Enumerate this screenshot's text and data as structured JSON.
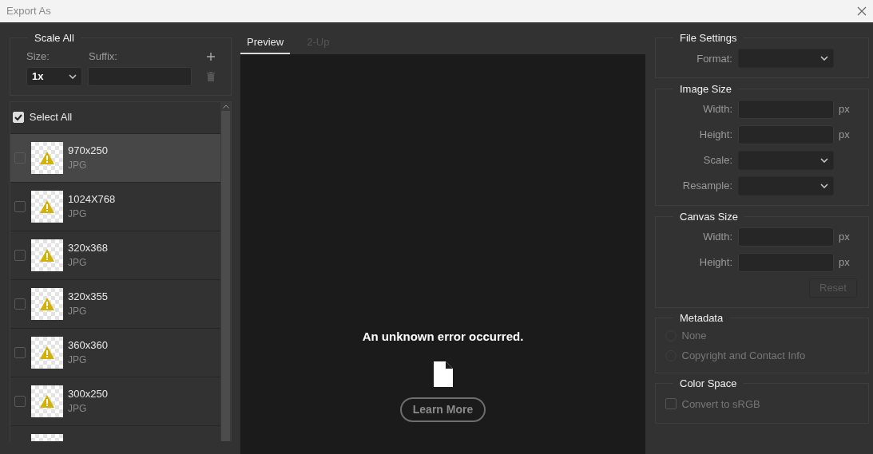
{
  "window": {
    "title": "Export As"
  },
  "scale_all": {
    "title": "Scale All",
    "size_label": "Size:",
    "suffix_label": "Suffix:",
    "size_value": "1x"
  },
  "list": {
    "select_all": {
      "label": "Select All",
      "checked": true
    },
    "items": [
      {
        "name": "970x250",
        "format": "JPG",
        "checked": false,
        "selected": true
      },
      {
        "name": "1024X768",
        "format": "JPG",
        "checked": false,
        "selected": false
      },
      {
        "name": "320x368",
        "format": "JPG",
        "checked": false,
        "selected": false
      },
      {
        "name": "320x355",
        "format": "JPG",
        "checked": false,
        "selected": false
      },
      {
        "name": "360x360",
        "format": "JPG",
        "checked": false,
        "selected": false
      },
      {
        "name": "300x250",
        "format": "JPG",
        "checked": false,
        "selected": false
      },
      {
        "selected": false
      }
    ]
  },
  "tabs": [
    {
      "label": "Preview",
      "selected": true
    },
    {
      "label": "2-Up",
      "selected": false
    }
  ],
  "preview": {
    "message": "An unknown error occurred.",
    "button": "Learn More"
  },
  "sections": [
    {
      "title": "File Settings",
      "rows": [
        {
          "kind": "select",
          "label": "Format:"
        }
      ]
    },
    {
      "title": "Image Size",
      "rows": [
        {
          "kind": "input",
          "label": "Width:",
          "unit": "px"
        },
        {
          "kind": "input",
          "label": "Height:",
          "unit": "px"
        },
        {
          "kind": "select",
          "label": "Scale:"
        },
        {
          "kind": "select",
          "label": "Resample:"
        }
      ]
    },
    {
      "title": "Canvas Size",
      "rows": [
        {
          "kind": "input",
          "label": "Width:",
          "unit": "px"
        },
        {
          "kind": "input",
          "label": "Height:",
          "unit": "px"
        },
        {
          "kind": "button",
          "label": "Reset",
          "disabled": true
        }
      ]
    },
    {
      "title": "Metadata",
      "rows": [
        {
          "kind": "radio",
          "label": "None",
          "selected": false,
          "disabled": true
        },
        {
          "kind": "radio",
          "label": "Copyright and Contact Info",
          "selected": false,
          "disabled": true
        }
      ]
    },
    {
      "title": "Color Space",
      "rows": [
        {
          "kind": "checkbox",
          "label": "Convert to sRGB",
          "checked": false,
          "disabled": true
        }
      ]
    }
  ]
}
